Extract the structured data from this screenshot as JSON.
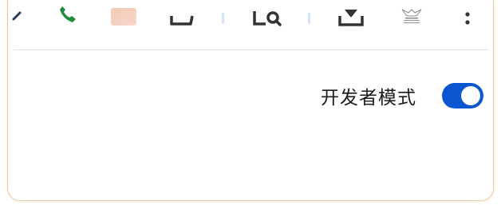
{
  "toolbar": {
    "icons": [
      "back-arrow-icon",
      "phone-icon",
      "app-thumbnail-icon",
      "share-icon",
      "find-in-page-icon",
      "download-icon",
      "site-logo-icon",
      "more-options-icon"
    ]
  },
  "settings": {
    "developer_mode_label": "开发者模式",
    "developer_mode_enabled": true
  },
  "colors": {
    "accent": "#0b57d0",
    "panel_border": "#ecc9a3",
    "separator": "#d7e2f8",
    "phone_green": "#1e8e3e"
  }
}
